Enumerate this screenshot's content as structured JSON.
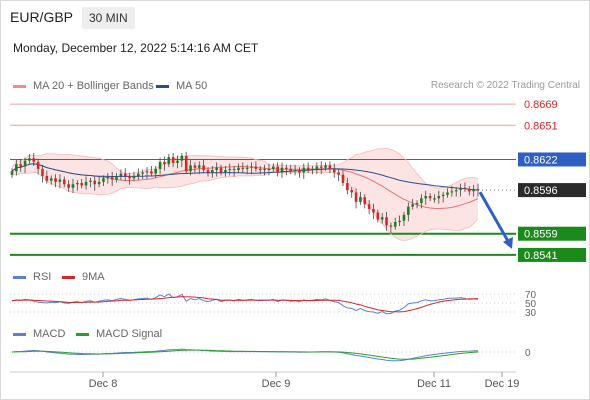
{
  "header": {
    "pair": "EUR/GBP",
    "timeframe": "30 MIN",
    "timestamp": "Monday, December 12, 2022 5:14:16 AM CET"
  },
  "legend": [
    {
      "label": "MA 20 + Bollinger Bands",
      "color": "#f28b82"
    },
    {
      "label": "MA 50",
      "color": "#2b4f8c"
    }
  ],
  "credit": "Research © 2022 Trading Central",
  "rsi_legend": [
    {
      "label": "RSI",
      "color": "#5b7fd6"
    },
    {
      "label": "9MA",
      "color": "#d62728"
    }
  ],
  "macd_legend": [
    {
      "label": "MACD",
      "color": "#5b7fd6"
    },
    {
      "label": "MACD Signal",
      "color": "#2ca02c"
    }
  ],
  "chart_data": {
    "type": "candlestick",
    "price_range": [
      0.8535,
      0.8675
    ],
    "x_ticks": [
      "Dec 8",
      "Dec 9",
      "Dec 11",
      "Dec 19"
    ],
    "closes": [
      0.8612,
      0.8618,
      0.8616,
      0.8621,
      0.8623,
      0.862,
      0.8614,
      0.8608,
      0.8604,
      0.8606,
      0.8603,
      0.8605,
      0.8601,
      0.8598,
      0.8601,
      0.8602,
      0.86,
      0.8603,
      0.8604,
      0.8601,
      0.8603,
      0.8606,
      0.8607,
      0.8605,
      0.8608,
      0.861,
      0.8608,
      0.8606,
      0.8608,
      0.861,
      0.8611,
      0.8612,
      0.861,
      0.8614,
      0.862,
      0.8618,
      0.8624,
      0.8619,
      0.8621,
      0.8625,
      0.8612,
      0.8617,
      0.8615,
      0.8617,
      0.8613,
      0.8611,
      0.8613,
      0.8615,
      0.8611,
      0.8613,
      0.8614,
      0.8613,
      0.8615,
      0.8614,
      0.8615,
      0.8616,
      0.8614,
      0.8613,
      0.8614,
      0.8614,
      0.8616,
      0.8611,
      0.8615,
      0.8614,
      0.8612,
      0.8613,
      0.8611,
      0.8615,
      0.8613,
      0.8614,
      0.8616,
      0.8615,
      0.8617,
      0.8614,
      0.8611,
      0.8609,
      0.8602,
      0.8596,
      0.8594,
      0.8586,
      0.859,
      0.8584,
      0.858,
      0.8577,
      0.8571,
      0.8573,
      0.8566,
      0.8565,
      0.8569,
      0.857,
      0.8575,
      0.8582,
      0.8584,
      0.8585,
      0.8589,
      0.8591,
      0.8589,
      0.8589,
      0.8591,
      0.8592,
      0.8594,
      0.8595,
      0.8596,
      0.8598,
      0.8597,
      0.8595,
      0.8597,
      0.8596
    ],
    "levels": [
      {
        "label": "0.8669",
        "value": 0.8669,
        "style": "thin-red"
      },
      {
        "label": "0.8651",
        "value": 0.8651,
        "style": "thin-red"
      },
      {
        "label": "0.8622",
        "value": 0.8622,
        "style": "blue"
      },
      {
        "label": "0.8596",
        "value": 0.8596,
        "style": "current"
      },
      {
        "label": "0.8559",
        "value": 0.8559,
        "style": "green"
      },
      {
        "label": "0.8541",
        "value": 0.8541,
        "style": "green"
      }
    ],
    "rsi": {
      "ticks": [
        "70",
        "50",
        "30"
      ],
      "values": [
        55,
        57,
        56,
        58,
        57,
        54,
        52,
        51,
        50,
        52,
        51,
        53,
        50,
        49,
        52,
        53,
        51,
        54,
        55,
        52,
        54,
        56,
        57,
        55,
        58,
        60,
        58,
        56,
        57,
        59,
        60,
        61,
        58,
        62,
        68,
        64,
        70,
        62,
        64,
        69,
        54,
        60,
        57,
        60,
        55,
        53,
        56,
        58,
        53,
        56,
        57,
        55,
        58,
        56,
        57,
        58,
        56,
        55,
        56,
        56,
        58,
        53,
        57,
        56,
        54,
        55,
        53,
        57,
        55,
        56,
        58,
        57,
        59,
        56,
        53,
        51,
        44,
        39,
        38,
        33,
        38,
        33,
        31,
        30,
        27,
        31,
        26,
        27,
        32,
        34,
        40,
        48,
        50,
        51,
        55,
        57,
        55,
        55,
        57,
        58,
        60,
        61,
        61,
        62,
        60,
        58,
        59,
        58
      ]
    },
    "macd": {
      "ticks": [
        "0"
      ]
    },
    "forecast": "arrow down toward 0.8541"
  }
}
